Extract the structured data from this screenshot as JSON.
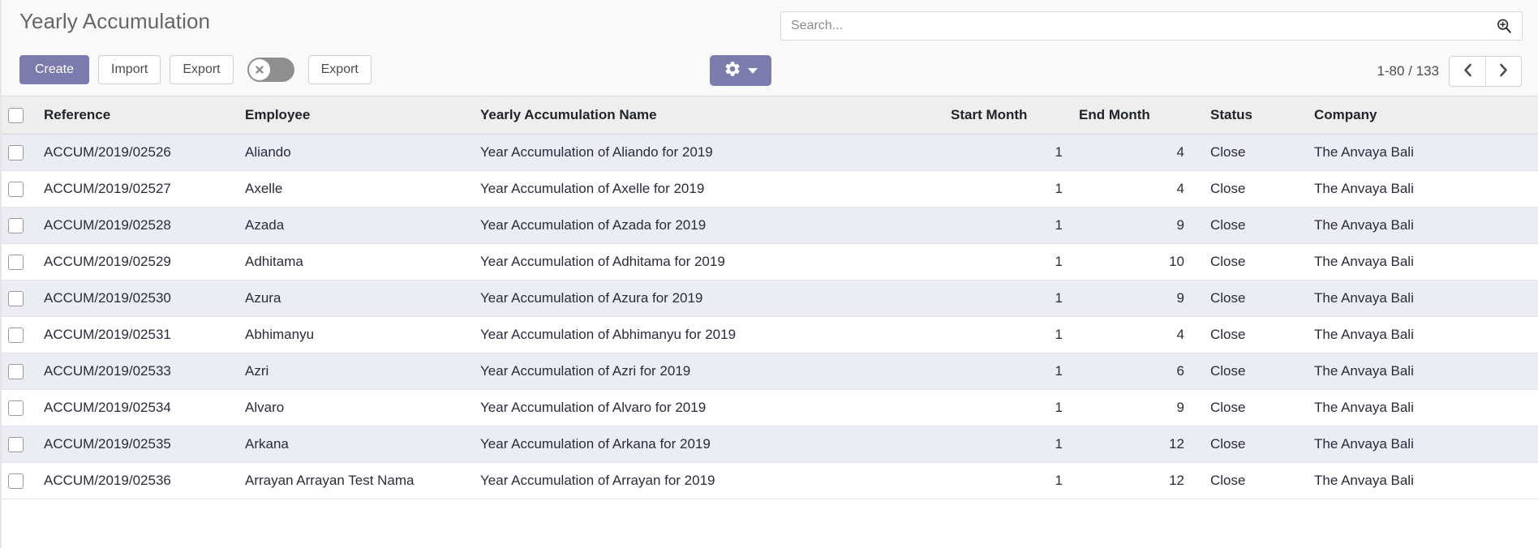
{
  "header": {
    "title": "Yearly Accumulation"
  },
  "toolbar": {
    "create_label": "Create",
    "import_label": "Import",
    "export_label": "Export",
    "export2_label": "Export",
    "toggle_state": "off",
    "toggle_icon": "close-circle-icon",
    "gear_icon": "gear-icon",
    "gear_caret_icon": "caret-down-icon"
  },
  "search": {
    "placeholder": "Search...",
    "value": "",
    "icon": "search-plus-icon"
  },
  "pager": {
    "range_label": "1-80 / 133",
    "prev_icon": "chevron-left-icon",
    "next_icon": "chevron-right-icon"
  },
  "table": {
    "columns": [
      "Reference",
      "Employee",
      "Yearly Accumulation Name",
      "Start Month",
      "End Month",
      "Status",
      "Company"
    ],
    "rows": [
      {
        "reference": "ACCUM/2019/02526",
        "employee": "Aliando",
        "name": "Year Accumulation of Aliando for 2019",
        "start_month": "1",
        "end_month": "4",
        "status": "Close",
        "company": "The Anvaya Bali"
      },
      {
        "reference": "ACCUM/2019/02527",
        "employee": "Axelle",
        "name": "Year Accumulation of Axelle  for 2019",
        "start_month": "1",
        "end_month": "4",
        "status": "Close",
        "company": "The Anvaya Bali"
      },
      {
        "reference": "ACCUM/2019/02528",
        "employee": "Azada",
        "name": "Year Accumulation of Azada  for 2019",
        "start_month": "1",
        "end_month": "9",
        "status": "Close",
        "company": "The Anvaya Bali"
      },
      {
        "reference": "ACCUM/2019/02529",
        "employee": "Adhitama",
        "name": "Year Accumulation of Adhitama for 2019",
        "start_month": "1",
        "end_month": "10",
        "status": "Close",
        "company": "The Anvaya Bali"
      },
      {
        "reference": "ACCUM/2019/02530",
        "employee": "Azura",
        "name": "Year Accumulation of Azura  for 2019",
        "start_month": "1",
        "end_month": "9",
        "status": "Close",
        "company": "The Anvaya Bali"
      },
      {
        "reference": "ACCUM/2019/02531",
        "employee": "Abhimanyu",
        "name": "Year Accumulation of Abhimanyu for 2019",
        "start_month": "1",
        "end_month": "4",
        "status": "Close",
        "company": "The Anvaya Bali"
      },
      {
        "reference": "ACCUM/2019/02533",
        "employee": "Azri",
        "name": "Year Accumulation of Azri  for 2019",
        "start_month": "1",
        "end_month": "6",
        "status": "Close",
        "company": "The Anvaya Bali"
      },
      {
        "reference": "ACCUM/2019/02534",
        "employee": "Alvaro",
        "name": "Year Accumulation of Alvaro  for 2019",
        "start_month": "1",
        "end_month": "9",
        "status": "Close",
        "company": "The Anvaya Bali"
      },
      {
        "reference": "ACCUM/2019/02535",
        "employee": "Arkana",
        "name": "Year Accumulation of Arkana for 2019",
        "start_month": "1",
        "end_month": "12",
        "status": "Close",
        "company": "The Anvaya Bali"
      },
      {
        "reference": "ACCUM/2019/02536",
        "employee": "Arrayan Arrayan Test Nama",
        "name": "Year Accumulation of Arrayan for 2019",
        "start_month": "1",
        "end_month": "12",
        "status": "Close",
        "company": "The Anvaya Bali"
      }
    ]
  },
  "colors": {
    "primary": "#7c7bad",
    "row_alt": "#ececf4",
    "header_bg": "#eeeeee",
    "panel_bg": "#f9f9f9",
    "toggle_off": "#8f8f8f"
  }
}
